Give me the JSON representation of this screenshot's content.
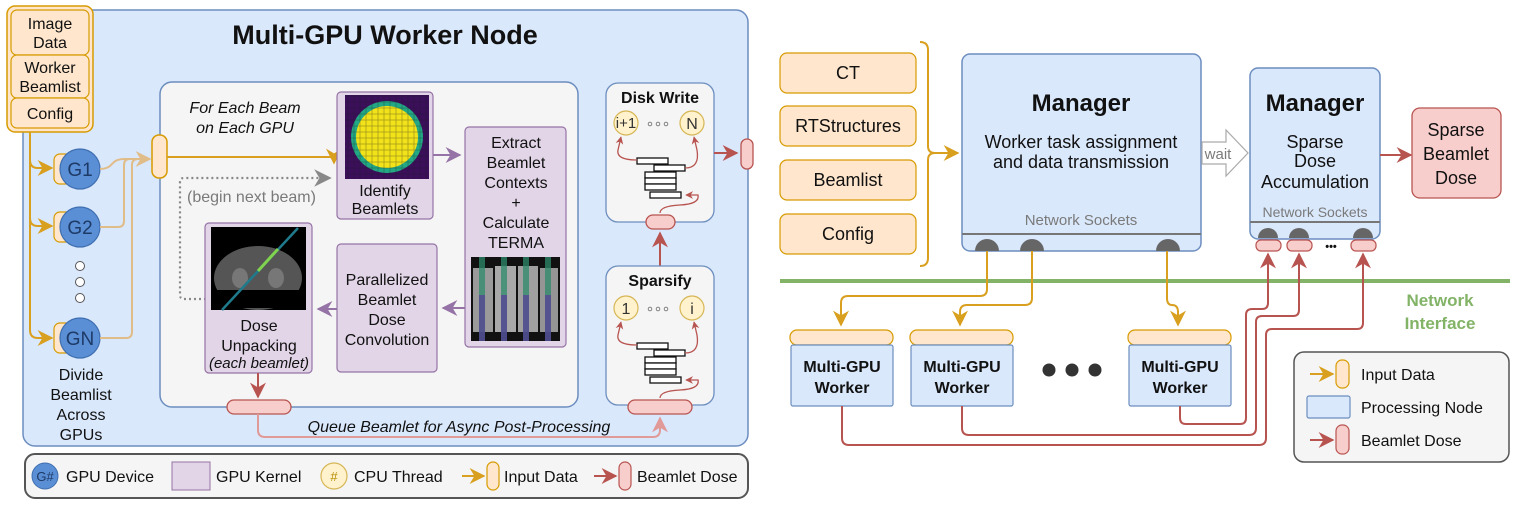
{
  "left_panel": {
    "title": "Multi-GPU Worker Node",
    "inputs": [
      {
        "label_lines": [
          "Image",
          "Data"
        ]
      },
      {
        "label_lines": [
          "Worker",
          "Beamlist"
        ]
      },
      {
        "label_lines": [
          "Config"
        ]
      }
    ],
    "gpus": [
      "G1",
      "G2",
      "GN"
    ],
    "divide_caption": [
      "Divide",
      "Beamlist",
      "Across",
      "GPUs"
    ],
    "loop_caption": [
      "For Each Beam",
      "on Each GPU"
    ],
    "begin_next_beam": "(begin next beam)",
    "kernels": {
      "identify": [
        "Identify",
        "Beamlets"
      ],
      "extract": [
        "Extract",
        "Beamlet",
        "Contexts",
        "+",
        "Calculate",
        "TERMA"
      ],
      "convolution": [
        "Parallelized",
        "Beamlet",
        "Dose",
        "Convolution"
      ],
      "unpacking": [
        "Dose",
        "Unpacking"
      ],
      "unpacking_note": "(each beamlet)"
    },
    "disk_write": {
      "title": "Disk Write",
      "threads": [
        "i+1",
        "N"
      ]
    },
    "sparsify": {
      "title": "Sparsify",
      "threads": [
        "1",
        "i"
      ]
    },
    "queue_caption": "Queue Beamlet for Async Post-Processing"
  },
  "left_legend": {
    "items": [
      {
        "icon": "G#",
        "label": "GPU Device"
      },
      {
        "icon": "",
        "label": "GPU Kernel"
      },
      {
        "icon": "#",
        "label": "CPU Thread"
      },
      {
        "icon": "",
        "label": "Input Data"
      },
      {
        "icon": "",
        "label": "Beamlet Dose"
      }
    ]
  },
  "right_panel": {
    "inputs": [
      "CT",
      "RTStructures",
      "Beamlist",
      "Config"
    ],
    "manager1": {
      "title": "Manager",
      "desc": [
        "Worker task assignment",
        "and data transmission"
      ],
      "sockets_label": "Network Sockets"
    },
    "wait_label": "wait",
    "manager2": {
      "title": "Manager",
      "desc": [
        "Sparse",
        "Dose",
        "Accumulation"
      ],
      "sockets_label": "Network Sockets",
      "ellipsis": "•••"
    },
    "output": [
      "Sparse",
      "Beamlet",
      "Dose"
    ],
    "network_interface": [
      "Network",
      "Interface"
    ],
    "workers": [
      [
        "Multi-GPU",
        "Worker"
      ],
      [
        "Multi-GPU",
        "Worker"
      ],
      [
        "Multi-GPU",
        "Worker"
      ]
    ]
  },
  "right_legend": {
    "items": [
      {
        "label": "Input Data"
      },
      {
        "label": "Processing Node"
      },
      {
        "label": "Beamlet Dose"
      }
    ]
  },
  "colors": {
    "panel_blue": "#dae8fc",
    "panel_blue_stroke": "#6c8ebf",
    "input_orange_fill": "#ffe6cc",
    "input_orange_stroke": "#d79b00",
    "arrow_orange": "#d9a020",
    "arrow_orange_light": "#e0bc88",
    "kernel_purple_fill": "#e1d5e7",
    "kernel_purple_stroke": "#9673a6",
    "dose_red_fill": "#f8cecc",
    "dose_red_stroke": "#b85450",
    "thread_yellow_fill": "#fff2cc",
    "thread_yellow_stroke": "#d6b656",
    "gpu_blue": "#5a8fd6",
    "network_green": "#82b366",
    "grey_box": "#f5f5f5"
  }
}
